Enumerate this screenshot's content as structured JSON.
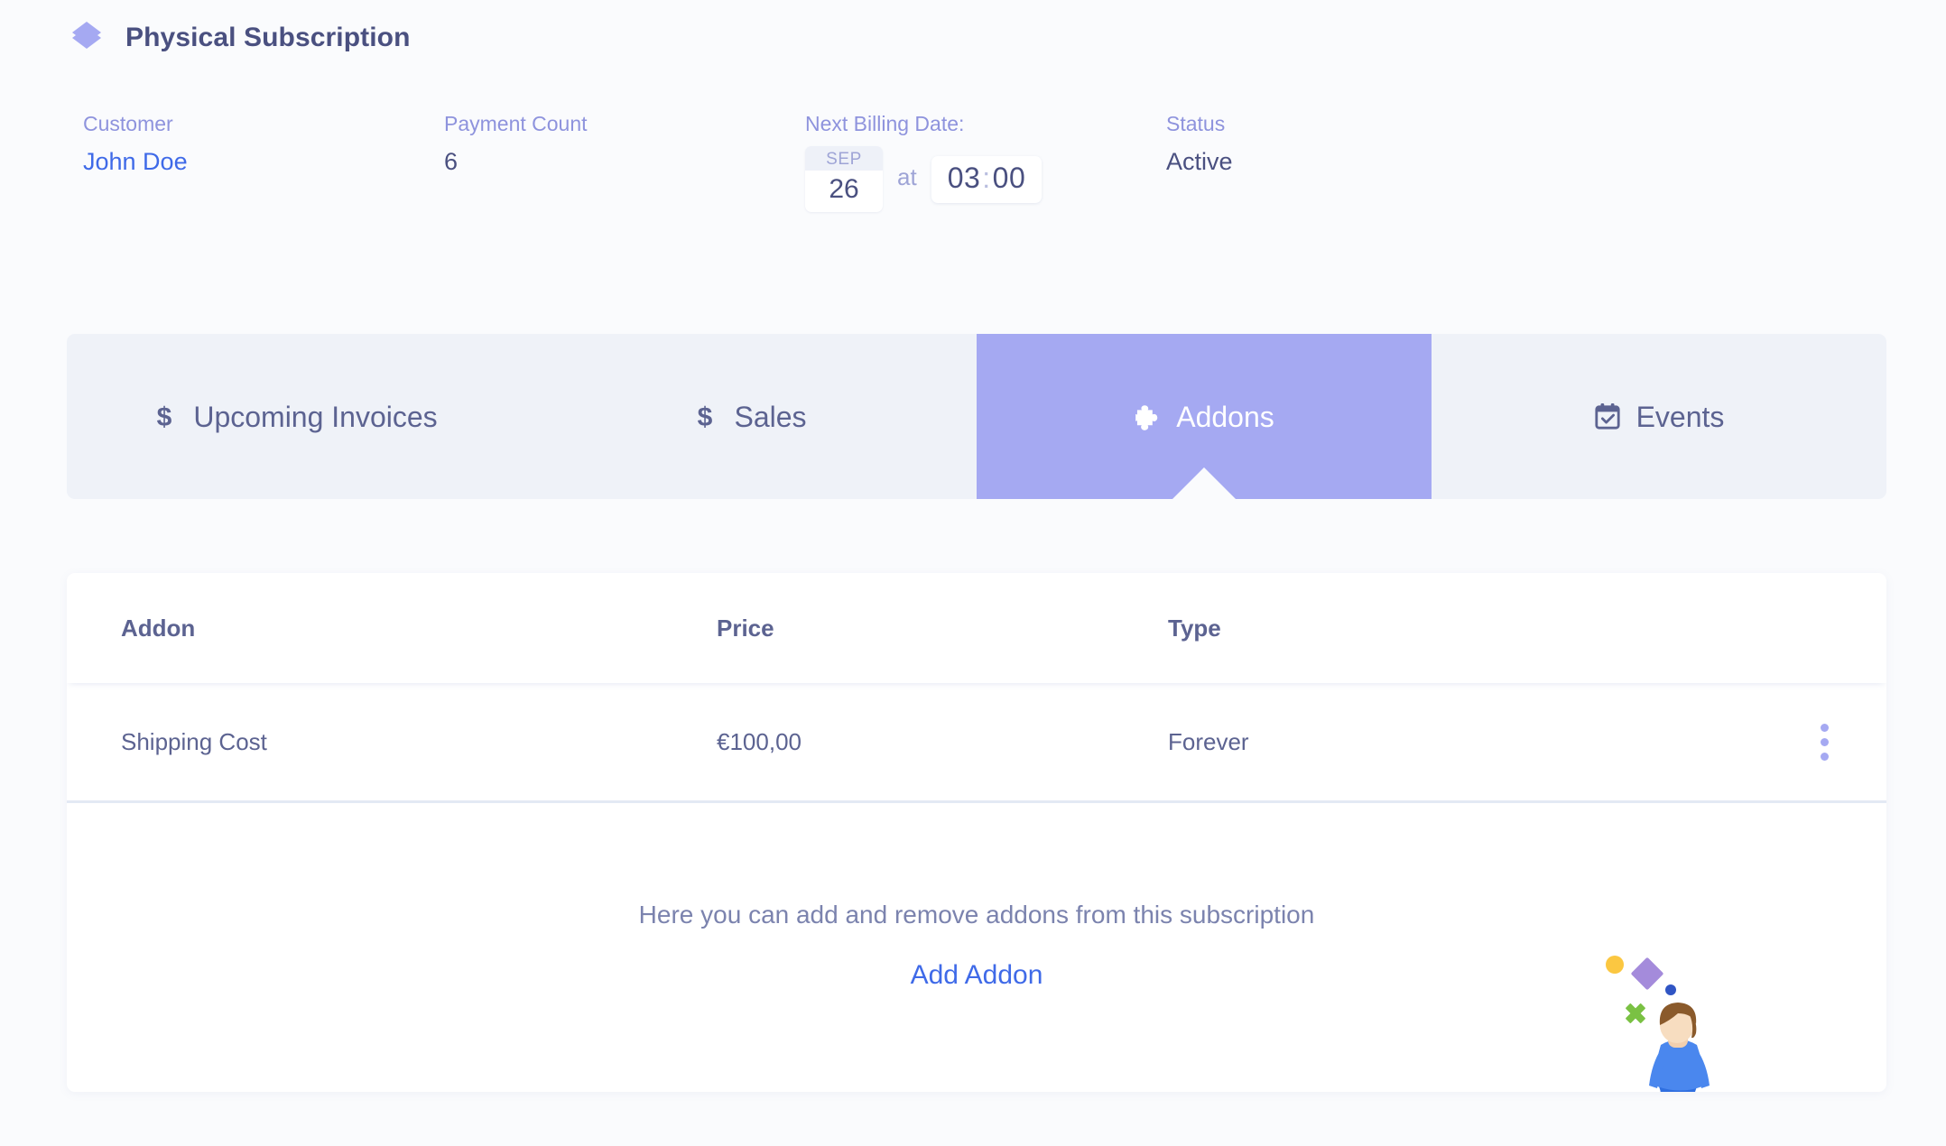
{
  "header": {
    "icon": "layers-icon",
    "title": "Physical Subscription",
    "accent_color": "#a5a9f2"
  },
  "summary": {
    "customer": {
      "label": "Customer",
      "value": "John Doe",
      "is_link": true
    },
    "payment_count": {
      "label": "Payment Count",
      "value": "6"
    },
    "next_billing": {
      "label": "Next Billing Date:",
      "month": "SEP",
      "day": "26",
      "at": "at",
      "hour": "03",
      "separator": ":",
      "minute": "00"
    },
    "status": {
      "label": "Status",
      "value": "Active"
    }
  },
  "tabs": [
    {
      "label": "Upcoming Invoices",
      "icon": "dollar-icon",
      "active": false
    },
    {
      "label": "Sales",
      "icon": "dollar-icon",
      "active": false
    },
    {
      "label": "Addons",
      "icon": "puzzle-piece-icon",
      "active": true
    },
    {
      "label": "Events",
      "icon": "calendar-check-icon",
      "active": false
    }
  ],
  "table": {
    "columns": [
      "Addon",
      "Price",
      "Type"
    ],
    "rows": [
      {
        "addon": "Shipping Cost",
        "price": "€100,00",
        "type": "Forever",
        "menu_icon": "kebab-menu-icon"
      }
    ]
  },
  "empty_state": {
    "message": "Here you can add and remove addons from this subscription",
    "action_label": "Add Addon",
    "illustration": "person-with-floating-shapes-illustration"
  },
  "colors": {
    "page_background": "#fafbfd",
    "tab_bar_background": "#eff2f8",
    "active_tab": "#a5a9f2",
    "label_purple": "#8e93dd",
    "value_slate": "#4a5080",
    "link_blue": "#3f6ae8"
  }
}
